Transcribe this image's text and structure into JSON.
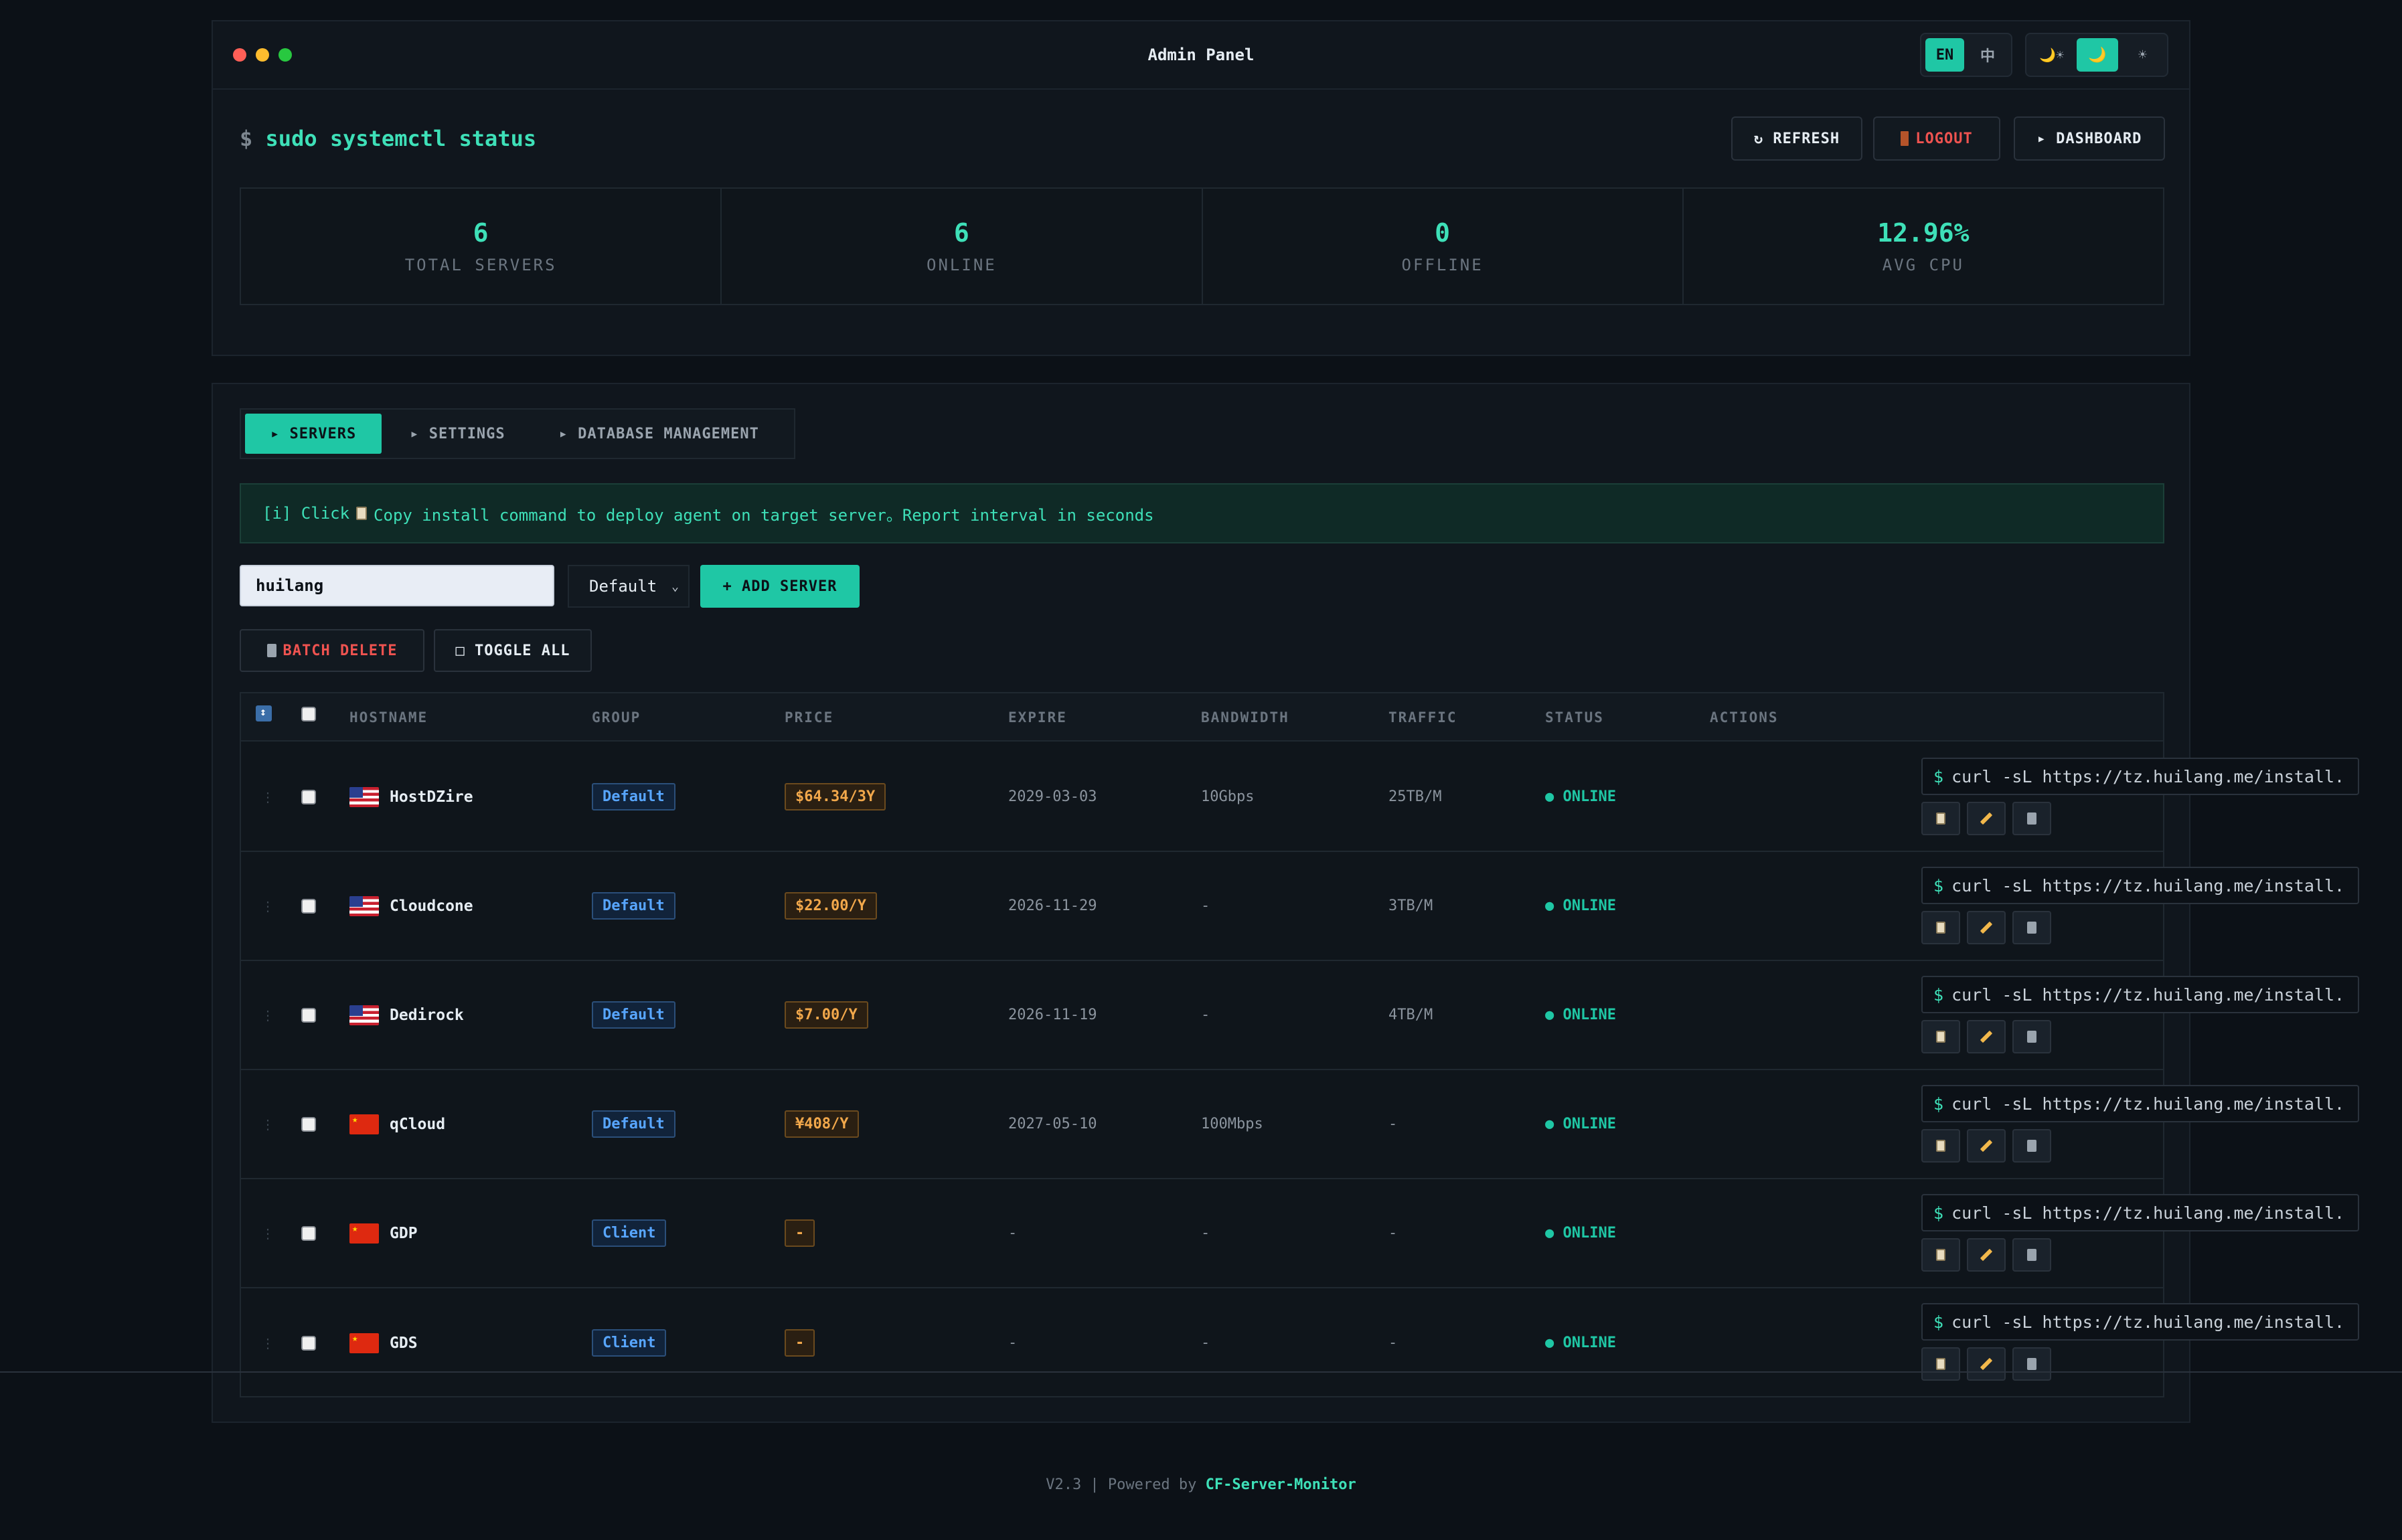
{
  "window": {
    "title": "Admin Panel"
  },
  "lang": {
    "en": "EN",
    "zh": "中"
  },
  "theme": {
    "auto": "🌙☀",
    "dark": "🌙",
    "light": "☀"
  },
  "header": {
    "prompt": "$",
    "command": "sudo systemctl status",
    "refresh": "↻ REFRESH",
    "logout": "LOGOUT",
    "dashboard": "▸ DASHBOARD"
  },
  "stats": [
    {
      "value": "6",
      "label": "TOTAL SERVERS"
    },
    {
      "value": "6",
      "label": "ONLINE"
    },
    {
      "value": "0",
      "label": "OFFLINE"
    },
    {
      "value": "12.96%",
      "label": "AVG CPU"
    }
  ],
  "tabs": [
    "▸ SERVERS",
    "▸ SETTINGS",
    "▸ DATABASE MANAGEMENT"
  ],
  "info": {
    "prefix": "[i] Click",
    "text": "Copy install command to deploy agent on target server。Report interval in seconds"
  },
  "search": {
    "value": "huilang"
  },
  "group_select": {
    "value": "Default"
  },
  "add_server": "+ ADD SERVER",
  "batch_delete": "BATCH DELETE",
  "toggle_all": "□ TOGGLE ALL",
  "columns": [
    "HOSTNAME",
    "GROUP",
    "PRICE",
    "EXPIRE",
    "BANDWIDTH",
    "TRAFFIC",
    "STATUS",
    "ACTIONS"
  ],
  "servers": [
    {
      "flag": "us",
      "hostname": "HostDZire",
      "group": "Default",
      "price": "$64.34/3Y",
      "expire": "2029-03-03",
      "bandwidth": "10Gbps",
      "traffic": "25TB/M",
      "status": "● ONLINE",
      "command": "curl -sL https://tz.huilang.me/install."
    },
    {
      "flag": "us",
      "hostname": "Cloudcone",
      "group": "Default",
      "price": "$22.00/Y",
      "expire": "2026-11-29",
      "bandwidth": "-",
      "traffic": "3TB/M",
      "status": "● ONLINE",
      "command": "curl -sL https://tz.huilang.me/install."
    },
    {
      "flag": "us",
      "hostname": "Dedirock",
      "group": "Default",
      "price": "$7.00/Y",
      "expire": "2026-11-19",
      "bandwidth": "-",
      "traffic": "4TB/M",
      "status": "● ONLINE",
      "command": "curl -sL https://tz.huilang.me/install."
    },
    {
      "flag": "cn",
      "hostname": "qCloud",
      "group": "Default",
      "price": "¥408/Y",
      "expire": "2027-05-10",
      "bandwidth": "100Mbps",
      "traffic": "-",
      "status": "● ONLINE",
      "command": "curl -sL https://tz.huilang.me/install."
    },
    {
      "flag": "cn",
      "hostname": "GDP",
      "group": "Client",
      "price": "-",
      "expire": "-",
      "bandwidth": "-",
      "traffic": "-",
      "status": "● ONLINE",
      "command": "curl -sL https://tz.huilang.me/install."
    },
    {
      "flag": "cn",
      "hostname": "GDS",
      "group": "Client",
      "price": "-",
      "expire": "-",
      "bandwidth": "-",
      "traffic": "-",
      "status": "● ONLINE",
      "command": "curl -sL https://tz.huilang.me/install."
    }
  ],
  "footer": {
    "version": "V2.3 | Powered by",
    "link": "CF-Server-Monitor"
  },
  "colors": {
    "accent": "#1fc7a5",
    "danger": "#ef5350",
    "background": "#0c1117"
  }
}
